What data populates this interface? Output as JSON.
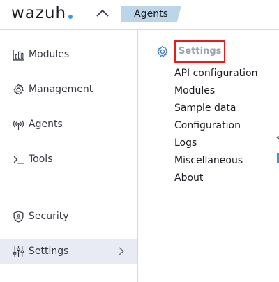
{
  "app": {
    "logo_text": "wazuh"
  },
  "header": {
    "breadcrumb": "Agents",
    "menu_toggle_icon": "chevron-up-icon"
  },
  "sidebar": {
    "items": [
      {
        "label": "Modules",
        "icon": "modules-chart-icon"
      },
      {
        "label": "Management",
        "icon": "gear-icon"
      },
      {
        "label": "Agents",
        "icon": "antenna-icon"
      },
      {
        "label": "Tools",
        "icon": "console-icon"
      },
      {
        "label": "Security",
        "icon": "shield-icon"
      },
      {
        "label": "Settings",
        "icon": "sliders-icon",
        "active": true
      }
    ]
  },
  "flyout": {
    "title": "Settings",
    "title_icon": "gear-icon",
    "items": [
      "API configuration",
      "Modules",
      "Sample data",
      "Configuration",
      "Logs",
      "Miscellaneous",
      "About"
    ]
  },
  "edge": {
    "partial_text": "s"
  },
  "colors": {
    "accent": "#3595f9",
    "breadcrumb_bg": "#bcd5e8",
    "active_bg": "#e8ebf3",
    "highlight_border": "#e81c1c"
  }
}
